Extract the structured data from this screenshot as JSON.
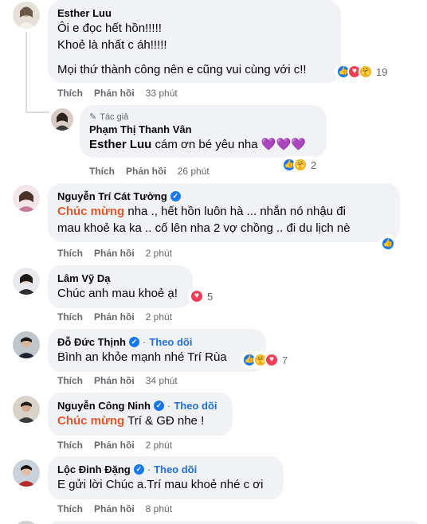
{
  "comments": [
    {
      "author": "Esther Luu",
      "lines": [
        "Ôi e đọc hết hồn!!!!!",
        "Khoẻ là nhất c áh!!!!!",
        "Mọi thứ thành công nên e cũng vui cùng với c!!"
      ],
      "reaction_count": "19",
      "like": "Thích",
      "reply": "Phản hồi",
      "time": "33 phút"
    },
    {
      "badge": "Tác giả",
      "author": "Phạm Thị Thanh Vân",
      "mention": "Esther Luu",
      "text": " cám ơn bé yêu nha 💜💜💜",
      "reaction_count": "2",
      "like": "Thích",
      "reply": "Phản hồi",
      "time": "26 phút"
    },
    {
      "author": "Nguyễn Trí Cát Tường",
      "highlight": "Chúc mừng",
      "line1_rest": " nha ., hết hồn luôn hà ... nhắn nó nhậu đi",
      "line2": "mau khoẻ ka ka .. cố lên nha 2 vợ chồng .. đi du lịch nè",
      "like": "Thích",
      "reply": "Phản hồi",
      "time": "2 phút"
    },
    {
      "author": "Lâm Vỹ Dạ",
      "text": "Chúc anh mau khoẻ ạ!",
      "reaction_count": "5",
      "like": "Thích",
      "reply": "Phản hồi",
      "time": "2 phút"
    },
    {
      "author": "Đỗ Đức Thịnh",
      "follow": "Theo dõi",
      "text": "Bình an khỏe mạnh nhé Trí Rùa",
      "reaction_count": "7",
      "like": "Thích",
      "reply": "Phản hồi",
      "time": "34 phút"
    },
    {
      "author": "Nguyễn Công Ninh",
      "follow": "Theo dõi",
      "highlight": "Chúc mừng",
      "rest": " Trí & GĐ nhe !",
      "like": "Thích",
      "reply": "Phản hồi",
      "time": "2 phút"
    },
    {
      "author": "Lộc Đinh Đặng",
      "follow": "Theo dõi",
      "text": "E gửi lời Chúc a.Trí mau khoẻ nhé c ơi",
      "like": "Thích",
      "reply": "Phản hồi",
      "time": "8 phút"
    }
  ],
  "colors": {
    "bubble": "#f0f2f5",
    "highlight": "#e4572e",
    "link": "#216fdb",
    "like": "#1877f2",
    "love": "#f33e58",
    "care": "#f7b125"
  },
  "icons": {
    "verified": "verified-badge-icon",
    "pen": "pen-icon",
    "like": "like-reaction-icon",
    "love": "love-reaction-icon",
    "care": "care-reaction-icon"
  },
  "glyphs": {
    "like": "👍",
    "love": "♥",
    "care": "🤗",
    "check": "✓",
    "pen": "✎"
  }
}
